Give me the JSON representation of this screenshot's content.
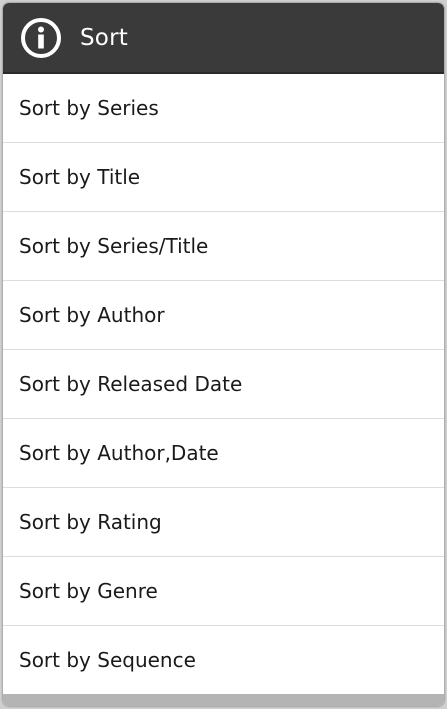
{
  "dialog": {
    "title": "Sort",
    "title_icon": "info-icon"
  },
  "menu": {
    "items": [
      {
        "label": "Sort by Series"
      },
      {
        "label": "Sort by Title"
      },
      {
        "label": "Sort by Series/Title"
      },
      {
        "label": "Sort by Author"
      },
      {
        "label": "Sort by Released Date"
      },
      {
        "label": "Sort by Author,Date"
      },
      {
        "label": "Sort by Rating"
      },
      {
        "label": "Sort by Genre"
      },
      {
        "label": "Sort by Sequence"
      }
    ]
  },
  "colors": {
    "title_bar_bg": "#3a3a3a",
    "title_text": "#ffffff",
    "item_text": "#1a1a1a",
    "divider": "#dcdcdc",
    "bottom_bar": "#b4b4b4"
  }
}
